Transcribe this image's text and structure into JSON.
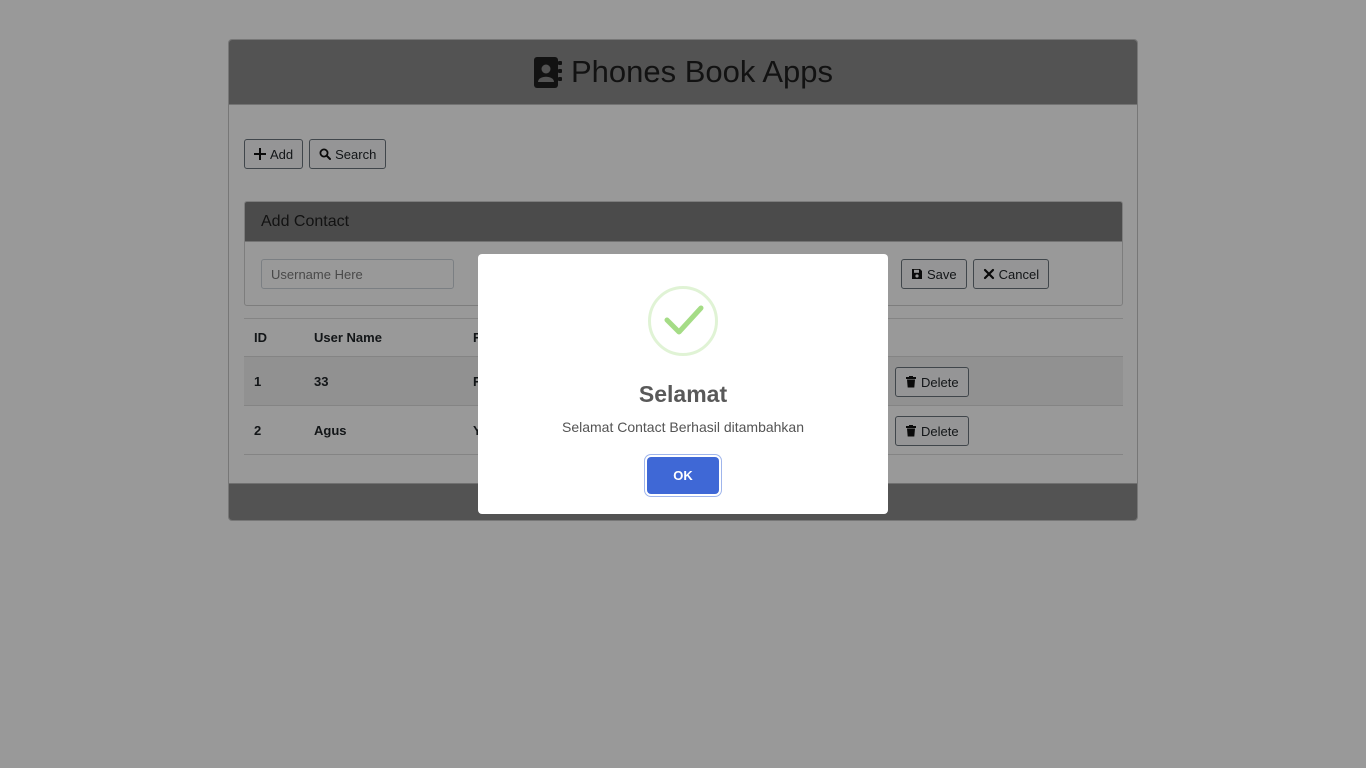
{
  "app": {
    "title": "Phones Book Apps",
    "icon": "address-book-icon"
  },
  "toolbar": {
    "add_label": "Add",
    "add_icon": "plus-icon",
    "search_label": "Search",
    "search_icon": "search-icon"
  },
  "add_contact": {
    "title": "Add Contact",
    "username_placeholder": "Username Here",
    "save_label": "Save",
    "save_icon": "floppy-disk-icon",
    "cancel_label": "Cancel",
    "cancel_icon": "times-icon"
  },
  "table": {
    "headers": [
      "ID",
      "User Name",
      "F"
    ],
    "rows": [
      {
        "id": "1",
        "username": "33",
        "phone_partial": "F",
        "delete_label": "Delete"
      },
      {
        "id": "2",
        "username": "Agus",
        "phone_partial": "Y",
        "delete_label": "Delete"
      }
    ]
  },
  "modal": {
    "icon": "success-check-icon",
    "title": "Selamat",
    "text": "Selamat Contact Berhasil ditambahkan",
    "ok_label": "OK"
  },
  "colors": {
    "overlay": "rgba(0,0,0,0.4)",
    "ok_button": "#3f68d6",
    "success_check": "#a5dc86"
  }
}
